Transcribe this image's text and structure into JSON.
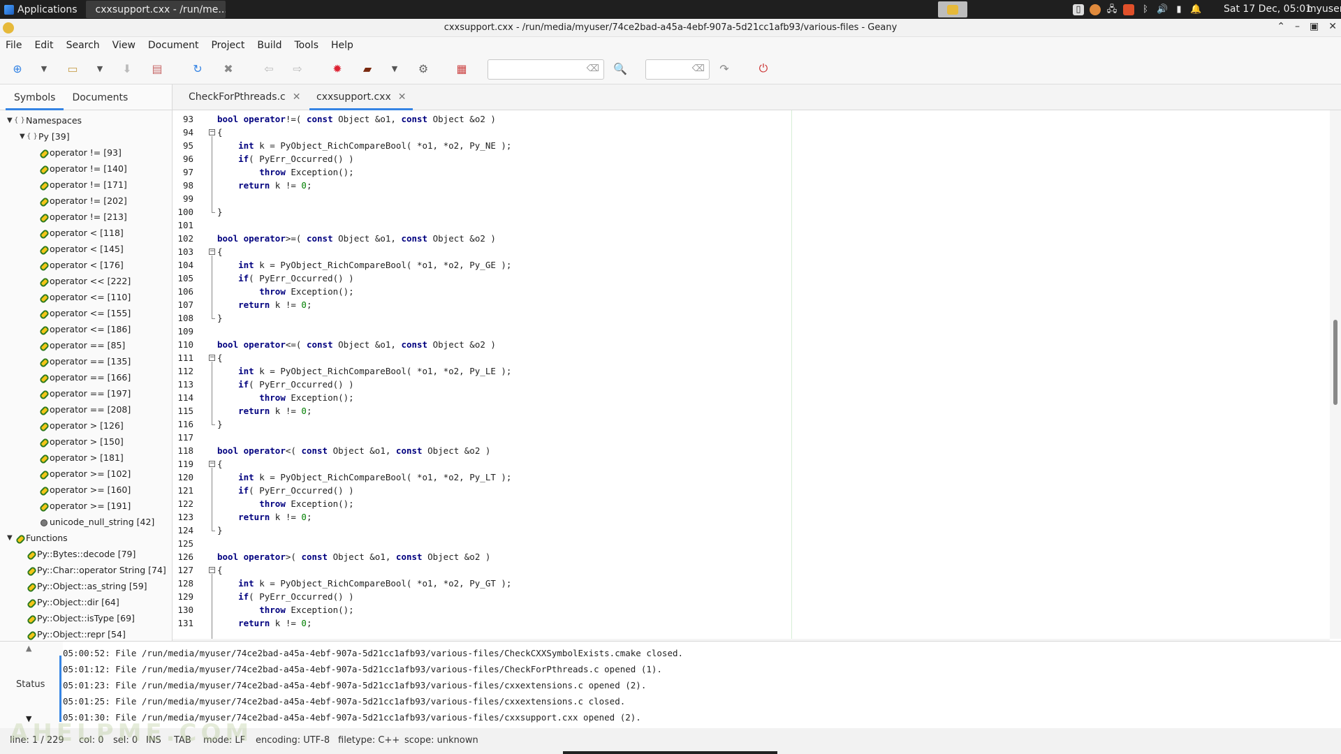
{
  "taskbar": {
    "applications_label": "Applications",
    "task_label": "cxxsupport.cxx - /run/me...",
    "clock": "Sat 17 Dec, 05:01",
    "user": "myuser"
  },
  "window": {
    "title": "cxxsupport.cxx - /run/media/myuser/74ce2bad-a45a-4ebf-907a-5d21cc1afb93/various-files - Geany"
  },
  "menu": [
    "File",
    "Edit",
    "Search",
    "View",
    "Document",
    "Project",
    "Build",
    "Tools",
    "Help"
  ],
  "toolbar": {
    "search_value": "",
    "goto_value": ""
  },
  "sidebar": {
    "tabs": [
      "Symbols",
      "Documents"
    ],
    "tree": [
      {
        "level": 0,
        "expander": "▼",
        "icon": "ns",
        "label": "Namespaces"
      },
      {
        "level": 1,
        "expander": "▼",
        "icon": "ns",
        "label": "Py [39]"
      },
      {
        "level": 2,
        "expander": "",
        "icon": "link",
        "label": "operator != [93]"
      },
      {
        "level": 2,
        "expander": "",
        "icon": "link",
        "label": "operator != [140]"
      },
      {
        "level": 2,
        "expander": "",
        "icon": "link",
        "label": "operator != [171]"
      },
      {
        "level": 2,
        "expander": "",
        "icon": "link",
        "label": "operator != [202]"
      },
      {
        "level": 2,
        "expander": "",
        "icon": "link",
        "label": "operator != [213]"
      },
      {
        "level": 2,
        "expander": "",
        "icon": "link",
        "label": "operator < [118]"
      },
      {
        "level": 2,
        "expander": "",
        "icon": "link",
        "label": "operator < [145]"
      },
      {
        "level": 2,
        "expander": "",
        "icon": "link",
        "label": "operator < [176]"
      },
      {
        "level": 2,
        "expander": "",
        "icon": "link",
        "label": "operator << [222]"
      },
      {
        "level": 2,
        "expander": "",
        "icon": "link",
        "label": "operator <= [110]"
      },
      {
        "level": 2,
        "expander": "",
        "icon": "link",
        "label": "operator <= [155]"
      },
      {
        "level": 2,
        "expander": "",
        "icon": "link",
        "label": "operator <= [186]"
      },
      {
        "level": 2,
        "expander": "",
        "icon": "link",
        "label": "operator == [85]"
      },
      {
        "level": 2,
        "expander": "",
        "icon": "link",
        "label": "operator == [135]"
      },
      {
        "level": 2,
        "expander": "",
        "icon": "link",
        "label": "operator == [166]"
      },
      {
        "level": 2,
        "expander": "",
        "icon": "link",
        "label": "operator == [197]"
      },
      {
        "level": 2,
        "expander": "",
        "icon": "link",
        "label": "operator == [208]"
      },
      {
        "level": 2,
        "expander": "",
        "icon": "link",
        "label": "operator > [126]"
      },
      {
        "level": 2,
        "expander": "",
        "icon": "link",
        "label": "operator > [150]"
      },
      {
        "level": 2,
        "expander": "",
        "icon": "link",
        "label": "operator > [181]"
      },
      {
        "level": 2,
        "expander": "",
        "icon": "link",
        "label": "operator >= [102]"
      },
      {
        "level": 2,
        "expander": "",
        "icon": "link",
        "label": "operator >= [160]"
      },
      {
        "level": 2,
        "expander": "",
        "icon": "link",
        "label": "operator >= [191]"
      },
      {
        "level": 2,
        "expander": "",
        "icon": "var",
        "label": "unicode_null_string [42]"
      },
      {
        "level": 0,
        "expander": "▼",
        "icon": "link",
        "label": "Functions"
      },
      {
        "level": 1,
        "expander": "",
        "icon": "link",
        "label": "Py::Bytes::decode [79]"
      },
      {
        "level": 1,
        "expander": "",
        "icon": "link",
        "label": "Py::Char::operator String [74]"
      },
      {
        "level": 1,
        "expander": "",
        "icon": "link",
        "label": "Py::Object::as_string [59]"
      },
      {
        "level": 1,
        "expander": "",
        "icon": "link",
        "label": "Py::Object::dir [64]"
      },
      {
        "level": 1,
        "expander": "",
        "icon": "link",
        "label": "Py::Object::isType [69]"
      },
      {
        "level": 1,
        "expander": "",
        "icon": "link",
        "label": "Py::Object::repr [54]"
      }
    ]
  },
  "editor": {
    "tabs": [
      {
        "label": "CheckForPthreads.c",
        "active": false
      },
      {
        "label": "cxxsupport.cxx",
        "active": true
      }
    ],
    "first_line": 93,
    "lines": [
      "bool operator!=( const Object &o1, const Object &o2 )",
      "{",
      "    int k = PyObject_RichCompareBool( *o1, *o2, Py_NE );",
      "    if( PyErr_Occurred() )",
      "        throw Exception();",
      "    return k != 0;",
      "",
      "}",
      "",
      "bool operator>=( const Object &o1, const Object &o2 )",
      "{",
      "    int k = PyObject_RichCompareBool( *o1, *o2, Py_GE );",
      "    if( PyErr_Occurred() )",
      "        throw Exception();",
      "    return k != 0;",
      "}",
      "",
      "bool operator<=( const Object &o1, const Object &o2 )",
      "{",
      "    int k = PyObject_RichCompareBool( *o1, *o2, Py_LE );",
      "    if( PyErr_Occurred() )",
      "        throw Exception();",
      "    return k != 0;",
      "}",
      "",
      "bool operator<( const Object &o1, const Object &o2 )",
      "{",
      "    int k = PyObject_RichCompareBool( *o1, *o2, Py_LT );",
      "    if( PyErr_Occurred() )",
      "        throw Exception();",
      "    return k != 0;",
      "}",
      "",
      "bool operator>( const Object &o1, const Object &o2 )",
      "{",
      "    int k = PyObject_RichCompareBool( *o1, *o2, Py_GT );",
      "    if( PyErr_Occurred() )",
      "        throw Exception();",
      "    return k != 0;"
    ]
  },
  "messages": {
    "tab_label": "Status",
    "lines": [
      "05:00:52: File /run/media/myuser/74ce2bad-a45a-4ebf-907a-5d21cc1afb93/various-files/CheckCXXSymbolExists.cmake closed.",
      "05:01:12: File /run/media/myuser/74ce2bad-a45a-4ebf-907a-5d21cc1afb93/various-files/CheckForPthreads.c opened (1).",
      "05:01:23: File /run/media/myuser/74ce2bad-a45a-4ebf-907a-5d21cc1afb93/various-files/cxxextensions.c opened (2).",
      "05:01:25: File /run/media/myuser/74ce2bad-a45a-4ebf-907a-5d21cc1afb93/various-files/cxxextensions.c closed.",
      "05:01:30: File /run/media/myuser/74ce2bad-a45a-4ebf-907a-5d21cc1afb93/various-files/cxxsupport.cxx opened (2)."
    ]
  },
  "statusbar": {
    "line": "line: 1 / 229",
    "col": "col: 0",
    "sel": "sel: 0",
    "ins": "INS",
    "tab": "TAB",
    "mode": "mode: LF",
    "encoding": "encoding: UTF-8",
    "filetype": "filetype: C++",
    "scope": "scope: unknown"
  },
  "watermark": "AHELPME.COM",
  "colors": {
    "keyword": "#00007f",
    "number": "#007f00",
    "accent": "#3584e4"
  }
}
